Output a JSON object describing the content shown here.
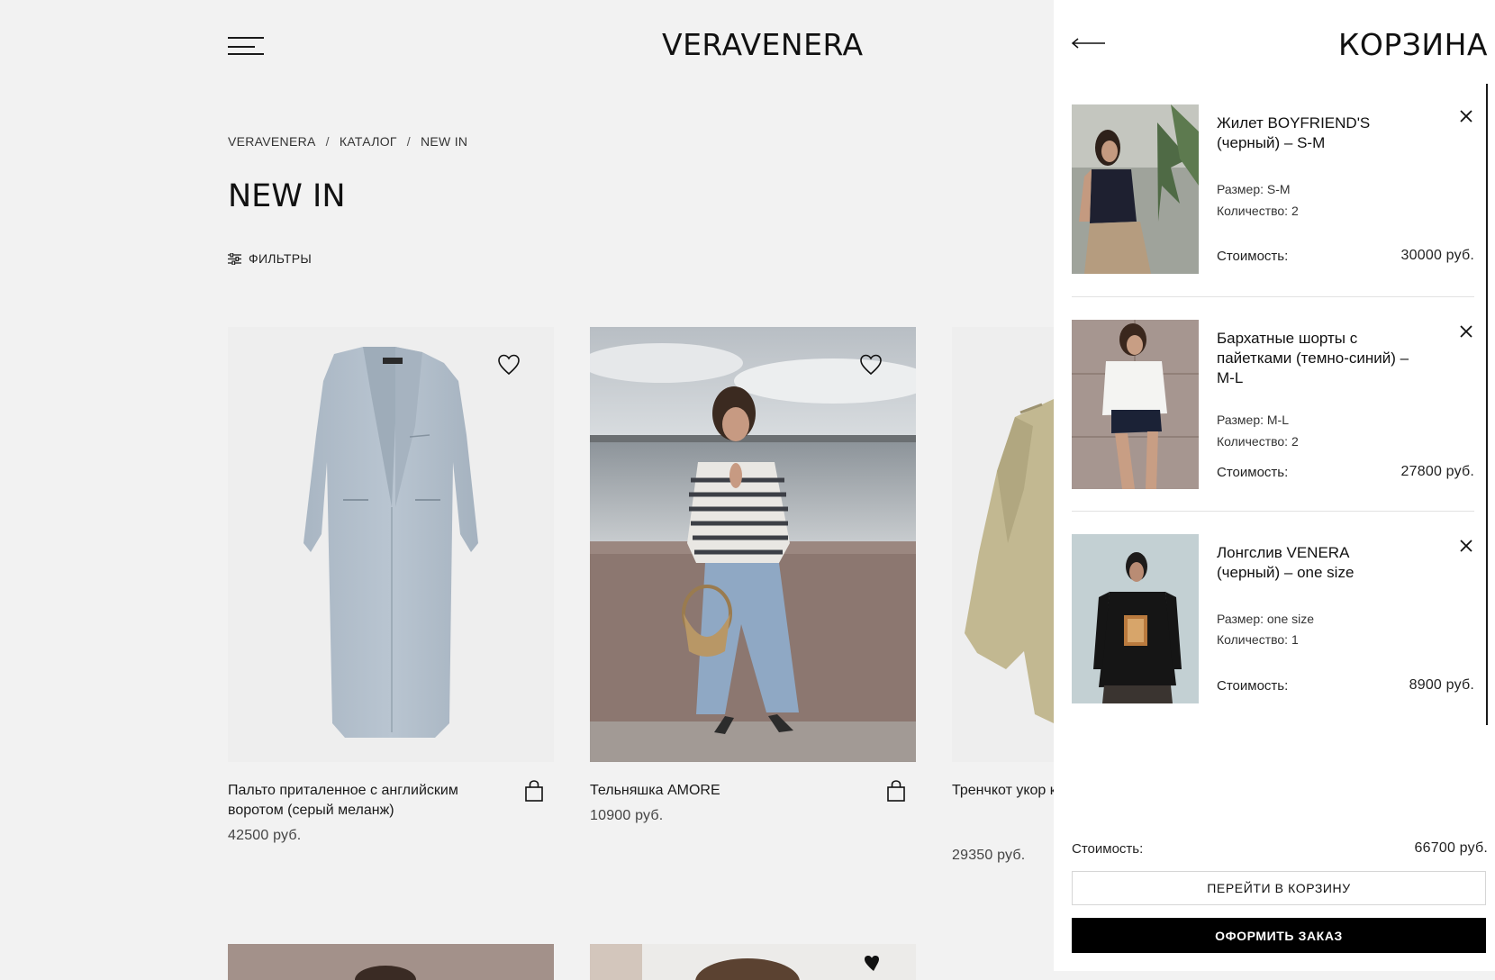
{
  "header": {
    "logo": "VERAVENERA"
  },
  "breadcrumb": [
    "VERAVENERA",
    "КАТАЛОГ",
    "NEW IN"
  ],
  "breadcrumb_sep": "/",
  "page": {
    "title": "NEW IN",
    "filters_label": "ФИЛЬТРЫ"
  },
  "products": [
    {
      "name": "Пальто приталенное с английским воротом (серый меланж)",
      "price": "42500 руб."
    },
    {
      "name": "Тельняшка AMORE",
      "price": "10900 руб."
    },
    {
      "name": "Тренчкот укор коketкой из пр (песочный)",
      "price": "29350 руб."
    }
  ],
  "cart": {
    "title": "КОРЗИНА",
    "items": [
      {
        "name": "Жилет BOYFRIEND'S (черный) – S-M",
        "size": "Размер: S-M",
        "qty": "Количество: 2",
        "cost_label": "Стоимость:",
        "cost": "30000 руб."
      },
      {
        "name": "Бархатные шорты с пайетками (темно-синий) – M-L",
        "size": "Размер: M-L",
        "qty": "Количество: 2",
        "cost_label": "Стоимость:",
        "cost": "27800 руб."
      },
      {
        "name": "Лонгслив VENERA (черный) – one size",
        "size": "Размер: one size",
        "qty": "Количество: 1",
        "cost_label": "Стоимость:",
        "cost": "8900 руб."
      }
    ],
    "total_label": "Стоимость:",
    "total_value": "66700 руб.",
    "go_to_cart": "ПЕРЕЙТИ В КОРЗИНУ",
    "checkout": "ОФОРМИТЬ ЗАКАЗ"
  }
}
